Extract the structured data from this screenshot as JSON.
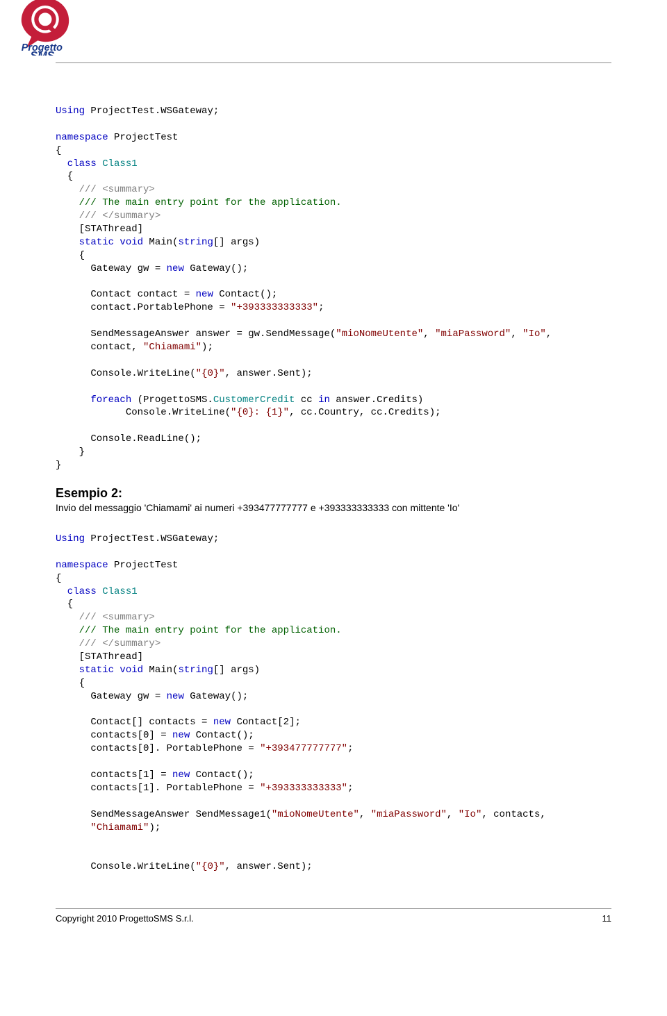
{
  "code1": {
    "l01a": "Using",
    "l01b": " ProjectTest.WSGateway;",
    "l03a": "namespace",
    "l03b": " ProjectTest",
    "l04": "{",
    "l05a": "  class",
    "l05b": " Class1",
    "l06": "  {",
    "l07": "    /// <summary>",
    "l08": "    /// The main entry point for the application.",
    "l09": "    /// </summary>",
    "l10": "    [STAThread]",
    "l11a": "    static",
    "l11b": " void",
    "l11c": " Main(",
    "l11d": "string",
    "l11e": "[] args)",
    "l12": "    {",
    "l13a": "      Gateway gw = ",
    "l13b": "new",
    "l13c": " Gateway();",
    "l15a": "      Contact contact = ",
    "l15b": "new",
    "l15c": " Contact();",
    "l16a": "      contact.PortablePhone = ",
    "l16b": "\"+393333333333\"",
    "l16c": ";",
    "l18a": "      SendMessageAnswer answer = gw.SendMessage(",
    "l18b": "\"mioNomeUtente\"",
    "l18c": ", ",
    "l18d": "\"miaPassword\"",
    "l18e": ", ",
    "l18f": "\"Io\"",
    "l18g": ",",
    "l18h": "      contact, ",
    "l18i": "\"Chiamami\"",
    "l18j": ");",
    "l20a": "      Console.WriteLine(",
    "l20b": "\"{0}\"",
    "l20c": ", answer.Sent);",
    "l22a": "      foreach",
    "l22b": " (ProgettoSMS.",
    "l22c": "CustomerCredit",
    "l22d": " cc ",
    "l22e": "in",
    "l22f": " answer.Credits)",
    "l23a": "            Console.WriteLine(",
    "l23b": "\"{0}: {1}\"",
    "l23c": ", cc.Country, cc.Credits);",
    "l25": "      Console.ReadLine();",
    "l26": "    }",
    "l27": "}"
  },
  "ex2": {
    "title": "Esempio 2:",
    "desc": "Invio del messaggio 'Chiamami' ai numeri +393477777777 e +393333333333 con mittente 'Io'"
  },
  "code2": {
    "l01a": "Using",
    "l01b": " ProjectTest.WSGateway;",
    "l03a": "namespace",
    "l03b": " ProjectTest",
    "l04": "{",
    "l05a": "  class",
    "l05b": " Class1",
    "l06": "  {",
    "l07": "    /// <summary>",
    "l08": "    /// The main entry point for the application.",
    "l09": "    /// </summary>",
    "l10": "    [STAThread]",
    "l11a": "    static",
    "l11b": " void",
    "l11c": " Main(",
    "l11d": "string",
    "l11e": "[] args)",
    "l12": "    {",
    "l13a": "      Gateway gw = ",
    "l13b": "new",
    "l13c": " Gateway();",
    "l15a": "      Contact[] contacts = ",
    "l15b": "new",
    "l15c": " Contact[2];",
    "l16a": "      contacts[0] = ",
    "l16b": "new",
    "l16c": " Contact();",
    "l17a": "      contacts[0]. PortablePhone = ",
    "l17b": "\"+393477777777\"",
    "l17c": ";",
    "l19a": "      contacts[1] = ",
    "l19b": "new",
    "l19c": " Contact();",
    "l20a": "      contacts[1]. PortablePhone = ",
    "l20b": "\"+393333333333\"",
    "l20c": ";",
    "l22a": "      SendMessageAnswer SendMessage1(",
    "l22b": "\"mioNomeUtente\"",
    "l22c": ", ",
    "l22d": "\"miaPassword\"",
    "l22e": ", ",
    "l22f": "\"Io\"",
    "l22g": ", contacts,",
    "l22h": "      ",
    "l22i": "\"Chiamami\"",
    "l22j": ");",
    "l25a": "      Console.WriteLine(",
    "l25b": "\"{0}\"",
    "l25c": ", answer.Sent);"
  },
  "footer": {
    "left": "Copyright  2010  ProgettoSMS S.r.l.",
    "right": "11"
  }
}
